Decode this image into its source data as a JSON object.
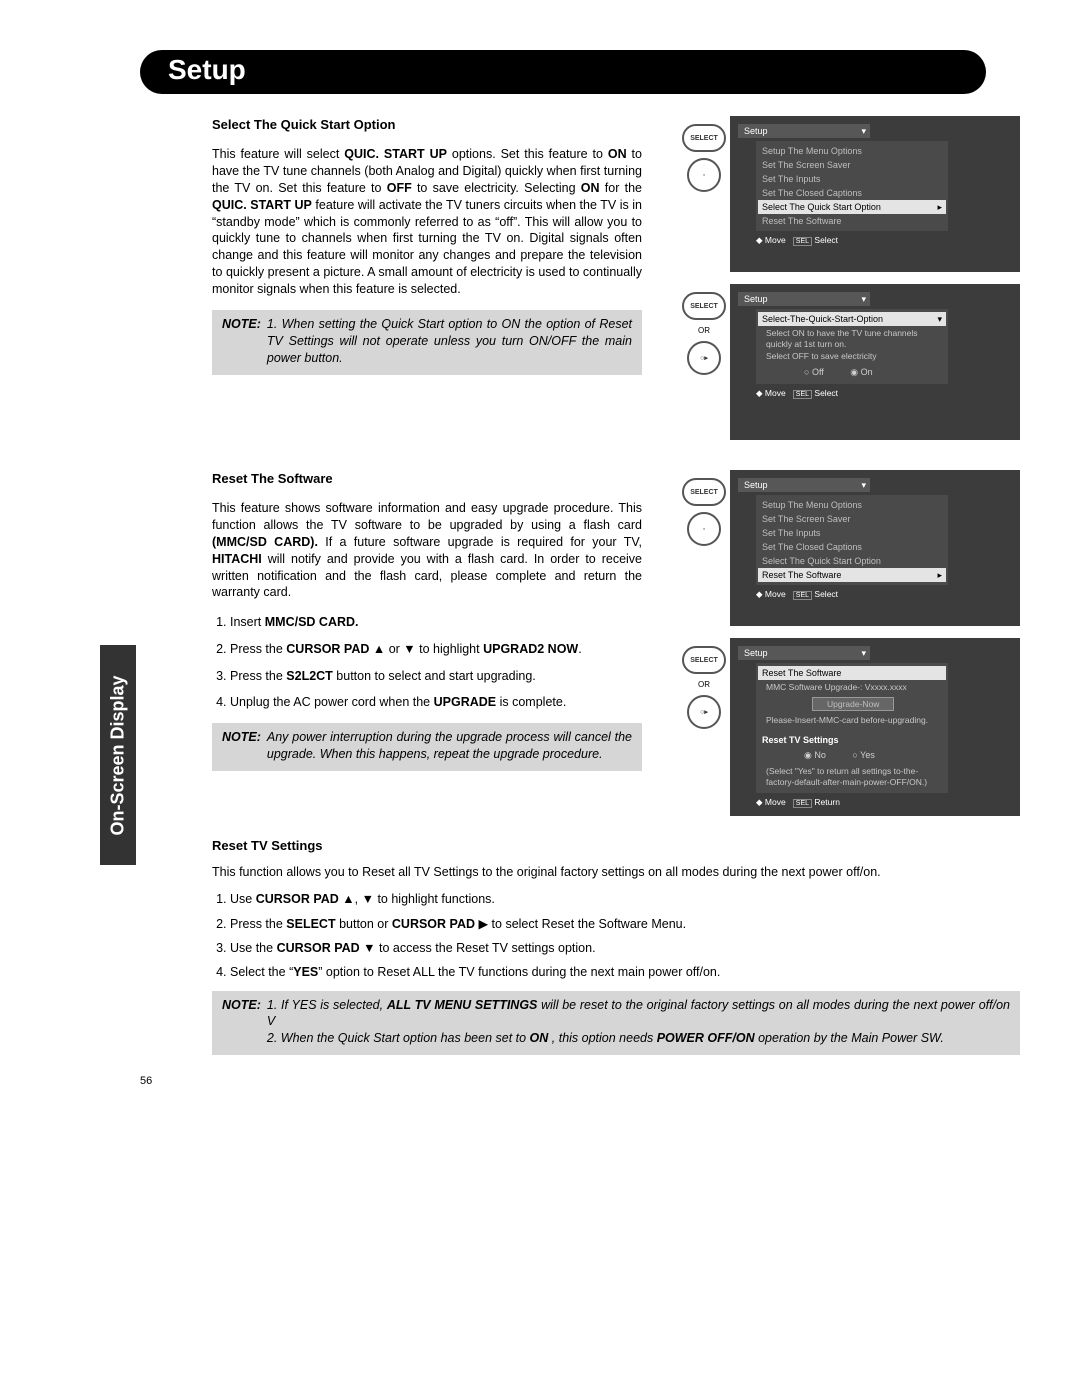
{
  "side_tab": "On-Screen Display",
  "title": "Setup",
  "page_number": "56",
  "section1": {
    "heading": "Select The Quick Start Option",
    "p1a": "This feature will select ",
    "p1b": "QUIC.  START UP",
    "p1c": " options. Set this feature to ",
    "p1d": "ON",
    "p1e": " to have the TV tune channels (both Analog and Digital) quickly when first turning the TV on. Set this feature to ",
    "p1f": "OFF",
    "p1g": " to save electricity. Selecting ",
    "p1h": "ON",
    "p1i": " for the ",
    "p1j": "QUIC.  START UP",
    "p1k": " feature will activate the TV tuners circuits when the TV is in “standby mode” which is commonly referred to as “off”. This will allow you to quickly tune to channels when first turning the TV on. Digital signals often change and this feature will monitor any changes and prepare the television to quickly present a picture. A small amount of electricity is used to continually monitor signals when this feature is selected.",
    "note_label": "NOTE:",
    "note_text": "1. When setting the Quick Start option to ON the option of Reset TV Settings will not operate unless you turn ON/OFF the main power button."
  },
  "section2": {
    "heading": "Reset The Software",
    "p1a": "This feature shows software information and easy upgrade procedure. This function allows the TV software to be upgraded by using a flash card ",
    "p1b": "(MMC/SD CARD).",
    "p1c": " If a future software upgrade is required for your TV, ",
    "p1d": "HITACHI",
    "p1e": " will notify and provide you with a flash card. In order to receive written notification and the flash card, please complete and return the warranty card.",
    "li1a": "Insert ",
    "li1b": "MMC/SD CARD.",
    "li2a": "Press the ",
    "li2b": "CURSOR PAD",
    "li2c": " ▲ or ▼ to highlight ",
    "li2d": "UPGRAD2 NOW",
    "li2e": ".",
    "li3a": "Press the ",
    "li3b": "S2L2CT",
    "li3c": " button to select and start upgrading.",
    "li4a": "Unplug the AC power cord when the ",
    "li4b": "UPGRADE",
    "li4c": " is complete.",
    "note_label": "NOTE:",
    "note_text": "Any power interruption during the upgrade process will cancel the upgrade. When this happens, repeat the upgrade procedure."
  },
  "section3": {
    "heading": "Reset TV Settings",
    "p1": "This function allows you to Reset all TV Settings to the original factory settings on all modes during the next power off/on.",
    "li1a": "Use ",
    "li1b": "CURSOR PAD",
    "li1c": " ▲, ▼ to highlight functions.",
    "li2a": "Press the ",
    "li2b": "SELECT",
    "li2c": " button or ",
    "li2d": "CURSOR PAD",
    "li2e": " ▶ to select Reset the Software Menu.",
    "li3a": "Use the ",
    "li3b": "CURSOR PAD",
    "li3c": " ▼ to access the Reset TV settings option.",
    "li4a": "Select the “",
    "li4b": "YES",
    "li4c": "” option to Reset ALL the TV functions during the next main power off/on.",
    "note_label": "NOTE:",
    "note1a": "1. If YES is selected, ",
    "note1b": "ALL TV MENU SETTINGS",
    "note1c": " will be reset to the original factory settings on all modes during the next power off/on V",
    "note2a": "2. When the Quick Start option has been set to ",
    "note2b": "ON",
    "note2c": " , this option needs ",
    "note2d": "POWER OFF/ON",
    "note2e": " operation by the Main Power SW."
  },
  "screens": {
    "setup_label": "Setup",
    "select_btn": "SELECT",
    "or": "OR",
    "m_options": "Setup The Menu Options",
    "m_saver": "Set The Screen Saver",
    "m_inputs": "Set The Inputs",
    "m_captions": "Set The Closed Captions",
    "m_quick": "Select The Quick Start Option",
    "m_reset": "Reset The Software",
    "move": "Move",
    "sel": "SEL",
    "select": "Select",
    "return": "Return",
    "hint1": "Select ON to have the TV tune channels quickly at 1st turn on.",
    "hint2": "Select OFF to save electricity",
    "off": "Off",
    "on": "On",
    "upg_title": "MMC Software Upgrade-:    Vxxxx.xxxx",
    "upg_btn": "Upgrade-Now",
    "upg_hint": "Please-Insert-MMC-card before-upgrading.",
    "rtv": "Reset TV Settings",
    "no": "No",
    "yes": "Yes",
    "rtv_hint": "(Select \"Yes\" to return all settings to-the-factory-default-after-main-power-OFF/ON.)"
  }
}
